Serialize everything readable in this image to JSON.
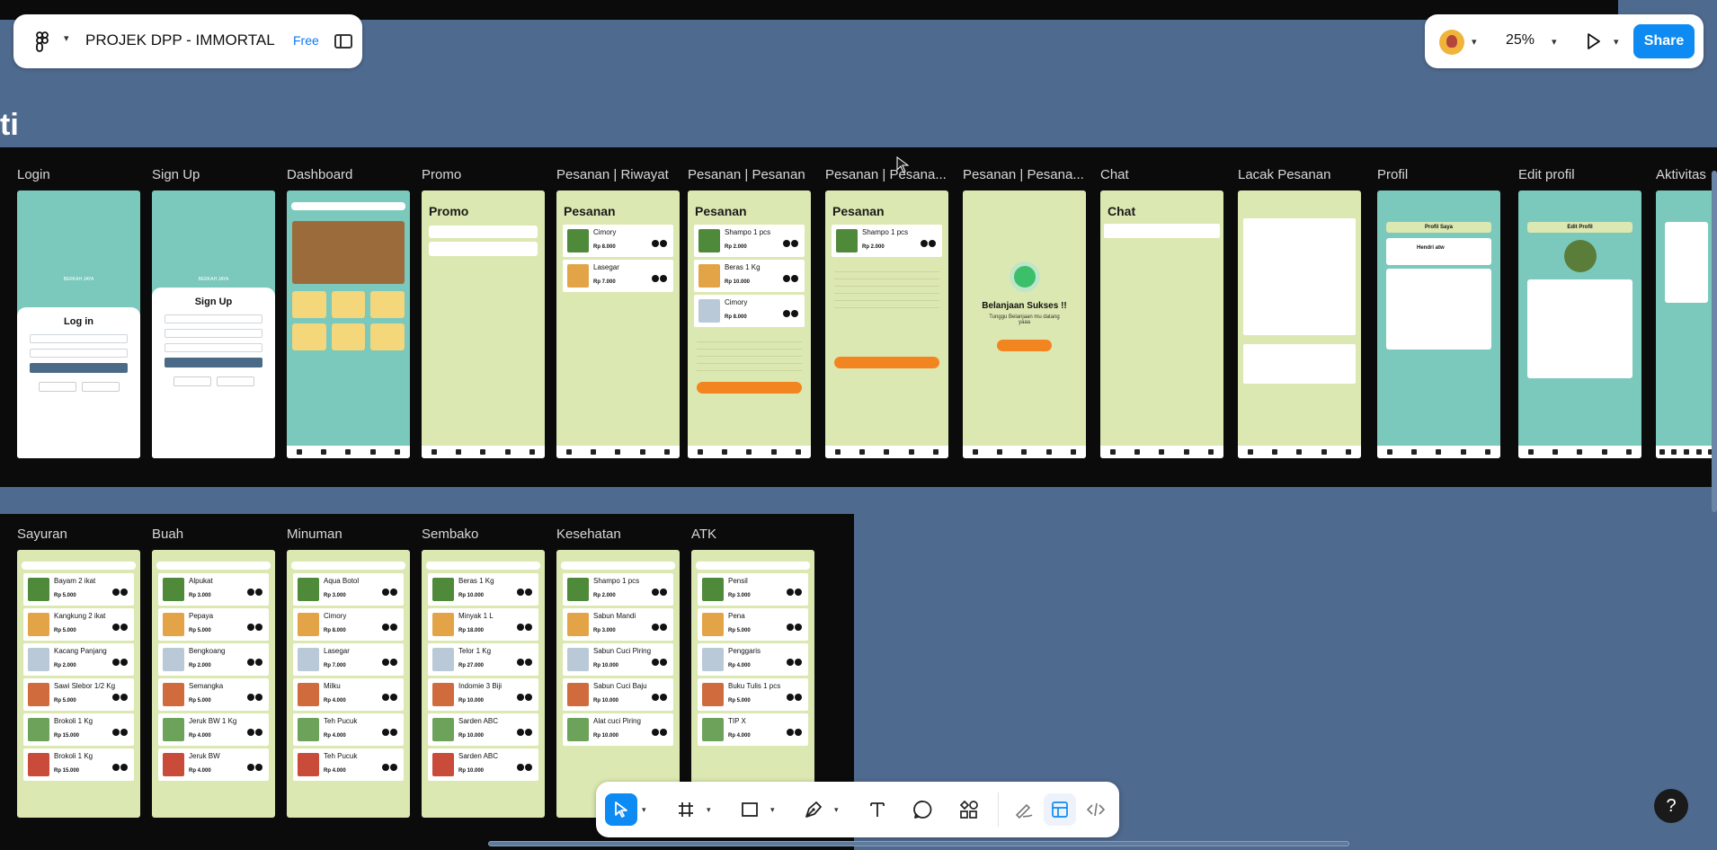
{
  "app": {
    "project_name": "PROJEK DPP - IMMORTAL",
    "plan_badge": "Free",
    "zoom": "25%",
    "share_label": "Share",
    "canvas_page_title": "ti",
    "help_label": "?"
  },
  "frames_row1": [
    {
      "label": "Login"
    },
    {
      "label": "Sign Up"
    },
    {
      "label": "Dashboard"
    },
    {
      "label": "Promo"
    },
    {
      "label": "Pesanan | Riwayat"
    },
    {
      "label": "Pesanan | Pesanan"
    },
    {
      "label": "Pesanan | Pesana..."
    },
    {
      "label": "Pesanan | Pesana..."
    },
    {
      "label": "Chat"
    },
    {
      "label": "Lacak Pesanan"
    },
    {
      "label": "Profil"
    },
    {
      "label": "Edit profil"
    },
    {
      "label": "Aktivitas"
    }
  ],
  "frames_row2": [
    {
      "label": "Sayuran"
    },
    {
      "label": "Buah"
    },
    {
      "label": "Minuman"
    },
    {
      "label": "Sembako"
    },
    {
      "label": "Kesehatan"
    },
    {
      "label": "ATK"
    }
  ],
  "screens": {
    "login": {
      "title": "Log in",
      "brand": "BERKAH JAYA"
    },
    "signup": {
      "title": "Sign Up",
      "brand": "BERKAH JAYA"
    },
    "promo": {
      "title": "Promo"
    },
    "pesanan_riwayat": {
      "title": "Pesanan",
      "items": [
        {
          "name": "Cimory",
          "price": "Rp 8.000"
        },
        {
          "name": "Lasegar",
          "price": "Rp 7.000"
        }
      ]
    },
    "pesanan_2": {
      "title": "Pesanan",
      "items": [
        {
          "name": "Shampo 1 pcs",
          "price": "Rp 2.000"
        },
        {
          "name": "Beras 1 Kg",
          "price": "Rp 10.000"
        },
        {
          "name": "Cimory",
          "price": "Rp 8.000"
        }
      ]
    },
    "pesanan_3": {
      "title": "Pesanan",
      "items": [
        {
          "name": "Shampo 1 pcs",
          "price": "Rp 2.000"
        }
      ]
    },
    "sukses": {
      "title": "Belanjaan Sukses !!",
      "subtitle": "Tunggu Belanjaan mu datang yaaa"
    },
    "chat": {
      "title": "Chat"
    },
    "profil": {
      "title": "Profil Saya",
      "name": "Hendri atw"
    },
    "edit_profil": {
      "title": "Edit Profil"
    }
  },
  "categories": {
    "sayuran": [
      {
        "name": "Bayam 2 ikat",
        "price": "Rp 5.000"
      },
      {
        "name": "Kangkung 2 ikat",
        "price": "Rp 5.000"
      },
      {
        "name": "Kacang Panjang",
        "price": "Rp 2.000"
      },
      {
        "name": "Sawi Slebor 1/2 Kg",
        "price": "Rp 5.000"
      },
      {
        "name": "Brokoli 1 Kg",
        "price": "Rp 15.000"
      },
      {
        "name": "Brokoli 1 Kg",
        "price": "Rp 15.000"
      }
    ],
    "buah": [
      {
        "name": "Alpukat",
        "price": "Rp 3.000"
      },
      {
        "name": "Pepaya",
        "price": "Rp 5.000"
      },
      {
        "name": "Bengkoang",
        "price": "Rp 2.000"
      },
      {
        "name": "Semangka",
        "price": "Rp 5.000"
      },
      {
        "name": "Jeruk BW 1 Kg",
        "price": "Rp 4.000"
      },
      {
        "name": "Jeruk BW",
        "price": "Rp 4.000"
      }
    ],
    "minuman": [
      {
        "name": "Aqua Botol",
        "price": "Rp 3.000"
      },
      {
        "name": "Cimory",
        "price": "Rp 8.000"
      },
      {
        "name": "Lasegar",
        "price": "Rp 7.000"
      },
      {
        "name": "Milku",
        "price": "Rp 4.000"
      },
      {
        "name": "Teh Pucuk",
        "price": "Rp 4.000"
      },
      {
        "name": "Teh Pucuk",
        "price": "Rp 4.000"
      }
    ],
    "sembako": [
      {
        "name": "Beras 1 Kg",
        "price": "Rp 10.000"
      },
      {
        "name": "Minyak 1 L",
        "price": "Rp 18.000"
      },
      {
        "name": "Telor 1 Kg",
        "price": "Rp 27.000"
      },
      {
        "name": "Indomie 3 Biji",
        "price": "Rp 10.000"
      },
      {
        "name": "Sarden ABC",
        "price": "Rp 10.000"
      },
      {
        "name": "Sarden ABC",
        "price": "Rp 10.000"
      }
    ],
    "kesehatan": [
      {
        "name": "Shampo 1 pcs",
        "price": "Rp 2.000"
      },
      {
        "name": "Sabun Mandi",
        "price": "Rp 3.000"
      },
      {
        "name": "Sabun Cuci Piring",
        "price": "Rp 10.000"
      },
      {
        "name": "Sabun Cuci Baju",
        "price": "Rp 10.000"
      },
      {
        "name": "Alat cuci Piring",
        "price": "Rp 10.000"
      }
    ],
    "atk": [
      {
        "name": "Pensil",
        "price": "Rp 3.000"
      },
      {
        "name": "Pena",
        "price": "Rp 5.000"
      },
      {
        "name": "Penggaris",
        "price": "Rp 4.000"
      },
      {
        "name": "Buku Tulis 1 pcs",
        "price": "Rp 5.000"
      },
      {
        "name": "TIP X",
        "price": "Rp 4.000"
      }
    ]
  },
  "toolbar": {
    "tools": [
      "move-tool",
      "frame-tool",
      "shape-tool",
      "pen-tool",
      "text-tool",
      "comment-tool",
      "actions-tool",
      "draw-mode",
      "design-mode",
      "dev-mode"
    ]
  },
  "colors": {
    "canvas": "#4f6a8f",
    "section": "#0b0b0b",
    "phone_bg": "#dbe8b1",
    "teal": "#7bc8bc",
    "accent": "#0d8bf2",
    "orange": "#f2851f"
  }
}
